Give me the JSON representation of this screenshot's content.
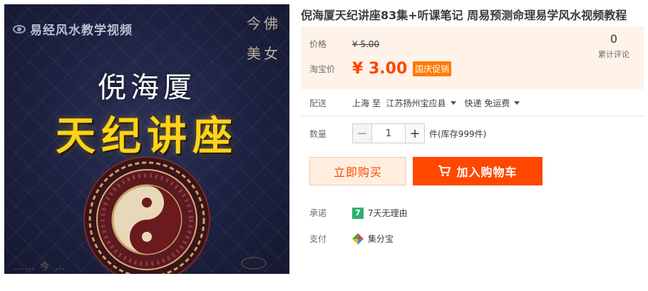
{
  "product": {
    "title": "倪海厦天纪讲座83集+听课笔记 周易预测命理易学风水视频教程"
  },
  "image": {
    "brand": "易经风水教学视频",
    "title_line1": "倪海厦",
    "title_line2": "天纪讲座",
    "seal_chars": [
      "今",
      "佛",
      "美",
      "女"
    ],
    "bottom_marks": "…… 今 …"
  },
  "price": {
    "label": "价格",
    "original": "¥ 5.00",
    "taobao_label": "淘宝价",
    "current": "¥ 3.00",
    "promo": "国庆促销",
    "review_count": "0",
    "review_label": "累计评论"
  },
  "shipping": {
    "label": "配送",
    "from": "上海",
    "to_word": "至",
    "destination": "江苏扬州宝应县",
    "method": "快递 免运费"
  },
  "quantity": {
    "label": "数量",
    "minus": "−",
    "value": "1",
    "plus": "+",
    "stock": "件(库存999件)"
  },
  "actions": {
    "buy_now": "立即购买",
    "add_cart": "加入购物车"
  },
  "promise": {
    "label": "承诺",
    "icon_text": "7",
    "text": "7天无理由"
  },
  "payment": {
    "label": "支付",
    "text": "集分宝"
  },
  "colors": {
    "accent": "#ff4400",
    "cart_button": "#ff4700",
    "price_box_bg": "#fff2e8",
    "promo_badge": "#ff7a00",
    "promise_icon": "#2fb06f"
  }
}
